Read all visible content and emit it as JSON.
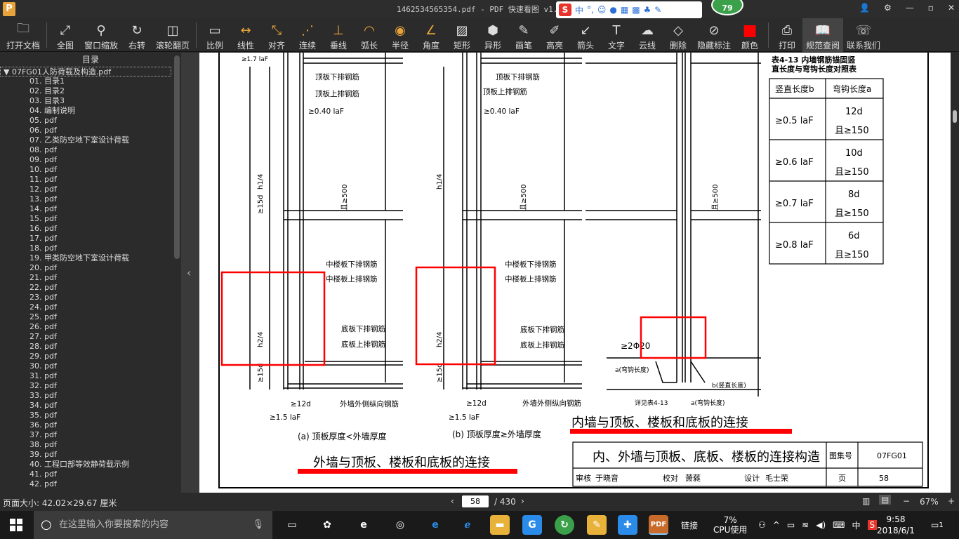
{
  "window": {
    "title": "1462534565354.pdf - PDF 快速看图 v1.9",
    "logo_letter": "P",
    "ime_label": "中",
    "ime_extra": "°,",
    "badge": "79"
  },
  "toolbar": [
    {
      "label": "打开文档",
      "icon": "folder-icon"
    },
    {
      "label": "全图",
      "icon": "fit-all-icon"
    },
    {
      "label": "窗口缩放",
      "icon": "zoom-icon"
    },
    {
      "label": "右转",
      "icon": "rotate-icon"
    },
    {
      "label": "滚轮翻页",
      "icon": "mouse-icon"
    },
    {
      "label": "比例",
      "icon": "ruler-icon"
    },
    {
      "label": "线性",
      "icon": "linear-dim-icon"
    },
    {
      "label": "对齐",
      "icon": "aligned-dim-icon"
    },
    {
      "label": "连续",
      "icon": "continuous-dim-icon"
    },
    {
      "label": "垂线",
      "icon": "perpendicular-icon"
    },
    {
      "label": "弧长",
      "icon": "arc-length-icon"
    },
    {
      "label": "半径",
      "icon": "radius-icon"
    },
    {
      "label": "角度",
      "icon": "angle-icon"
    },
    {
      "label": "矩形",
      "icon": "rectangle-icon"
    },
    {
      "label": "异形",
      "icon": "polygon-icon"
    },
    {
      "label": "画笔",
      "icon": "pencil-icon"
    },
    {
      "label": "高亮",
      "icon": "highlighter-icon"
    },
    {
      "label": "箭头",
      "icon": "arrow-icon"
    },
    {
      "label": "文字",
      "icon": "text-icon"
    },
    {
      "label": "云线",
      "icon": "cloud-icon"
    },
    {
      "label": "删除",
      "icon": "eraser-icon"
    },
    {
      "label": "隐藏标注",
      "icon": "eye-off-icon"
    },
    {
      "label": "颜色",
      "icon": "color-swatch-icon",
      "color": "#ff0000"
    },
    {
      "label": "打印",
      "icon": "print-icon"
    },
    {
      "label": "规范查阅",
      "icon": "book-icon"
    },
    {
      "label": "联系我们",
      "icon": "contact-icon"
    }
  ],
  "sidebar": {
    "header": "目录",
    "root": "07FG01人防荷载及构造.pdf",
    "items": [
      "01. 目录1",
      "02. 目录2",
      "03. 目录3",
      "04. 编制说明",
      "05. pdf",
      "06. pdf",
      "07. 乙类防空地下室设计荷载",
      "08. pdf",
      "09. pdf",
      "10. pdf",
      "11. pdf",
      "12. pdf",
      "13. pdf",
      "14. pdf",
      "15. pdf",
      "16. pdf",
      "17. pdf",
      "18. pdf",
      "19. 甲类防空地下室设计荷载",
      "20. pdf",
      "21. pdf",
      "22. pdf",
      "23. pdf",
      "24. pdf",
      "25. pdf",
      "26. pdf",
      "27. pdf",
      "28. pdf",
      "29. pdf",
      "30. pdf",
      "31. pdf",
      "32. pdf",
      "33. pdf",
      "34. pdf",
      "35. pdf",
      "36. pdf",
      "37. pdf",
      "38. pdf",
      "39. pdf",
      "40. 工程口部等效静荷载示例",
      "41. pdf",
      "42. pdf"
    ]
  },
  "document": {
    "table_title": "表4-13  内墙钢筋锚固竖",
    "table_title2": "直长度与弯钩长度对照表",
    "table_headers": [
      "竖直长度b",
      "弯钩长度a"
    ],
    "table_rows": [
      {
        "b": "≥0.5 laF",
        "a1": "12d",
        "a2": "且≥150"
      },
      {
        "b": "≥0.6 laF",
        "a1": "10d",
        "a2": "且≥150"
      },
      {
        "b": "≥0.7 laF",
        "a1": "8d",
        "a2": "且≥150"
      },
      {
        "b": "≥0.8 laF",
        "a1": "6d",
        "a2": "且≥150"
      }
    ],
    "labels": {
      "top_lower": "顶板下排钢筋",
      "top_upper": "顶板上排钢筋",
      "mid_lower": "中楼板下排钢筋",
      "mid_upper": "中楼板上排钢筋",
      "bot_lower": "底板下排钢筋",
      "bot_upper": "底板上排钢筋",
      "outer_long": "外墙外侧纵向钢筋",
      "laf": "≥0.40 laF",
      "d12": "≥12d",
      "l15": "≥1.5 laF",
      "d15": "≥15d",
      "h1": "h1/4",
      "h2": "h2/4",
      "d20": "≥2Φ20",
      "anchor": "b(竖直长度)",
      "hook": "a(弯钩长度)",
      "note": "详见表4-13",
      "ge500": "且≥500",
      "ge17": "≥1.7 laF",
      "lf": "lF"
    },
    "caption_a": "(a)  顶板厚度<外墙厚度",
    "caption_b": "(b)  顶板厚度≥外墙厚度",
    "heading_inner": "内墙与顶板、楼板和底板的连接",
    "heading_outer": "外墙与顶板、楼板和底板的连接",
    "titleblock_main": "内、外墙与顶板、底板、楼板的连接构造",
    "titleblock_label": "图集号",
    "titleblock_code": "07FG01",
    "tb_row": [
      "审核",
      "于晓音",
      "校对",
      "萧蕤",
      "设计",
      "毛士荣",
      "页",
      "58"
    ]
  },
  "status": {
    "page_size": "页面大小: 42.02×29.67 厘米",
    "page_current": "58",
    "page_total": "/ 430",
    "zoom": "67%"
  },
  "taskbar": {
    "search_placeholder": "在这里输入你要搜索的内容",
    "link": "链接",
    "cpu": "7%",
    "cpu_label": "CPU使用",
    "ime": "中",
    "time": "9:58",
    "date": "2018/6/1",
    "notif": "1"
  }
}
